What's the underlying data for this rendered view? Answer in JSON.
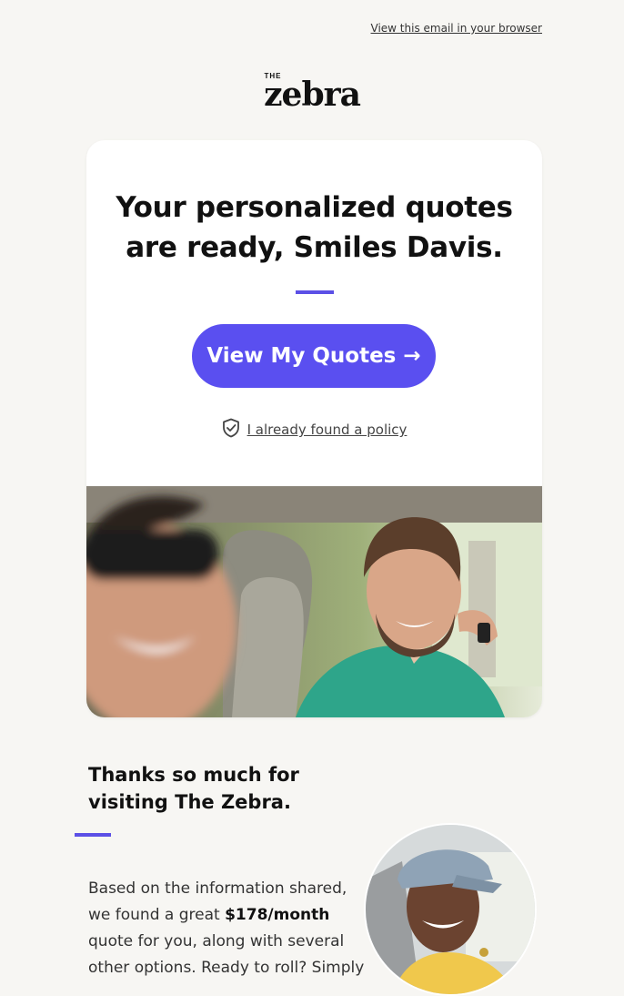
{
  "header": {
    "view_in_browser": "View this email in your browser",
    "logo_the": "THE",
    "logo_name": "zebra"
  },
  "hero": {
    "title_line1": "Your personalized quotes",
    "title_line2": "are ready, Smiles Davis.",
    "cta_label": "View My Quotes →",
    "policy_link": "I already found a policy"
  },
  "section": {
    "heading_line1": "Thanks so much for",
    "heading_line2": "visiting The Zebra.",
    "body_before": "Based on the information shared, we found a great ",
    "body_price": "$178/month",
    "body_after": " quote for you, along with several other options. Ready to roll? Simply"
  },
  "colors": {
    "accent": "#5a4ff0",
    "background": "#f7f6f3"
  },
  "icons": {
    "policy": "shield-check-icon"
  }
}
